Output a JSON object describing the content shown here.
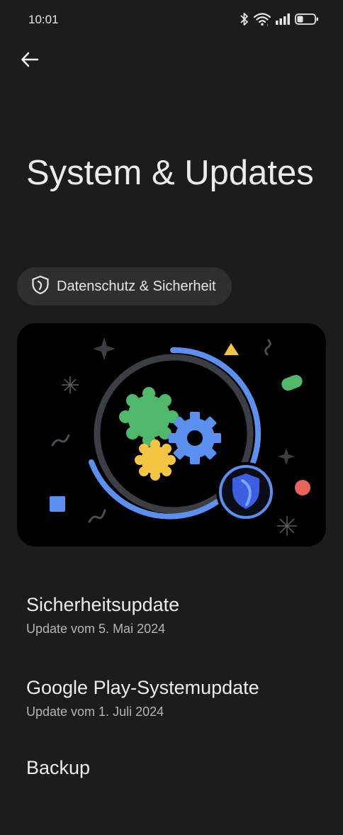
{
  "status_bar": {
    "time": "10:01",
    "icons": [
      "bluetooth-icon",
      "wifi-icon",
      "cell-signal-icon",
      "battery-icon"
    ],
    "battery_level": 0.35
  },
  "header": {
    "back_icon": "arrow-back-icon",
    "title": "System & Updates"
  },
  "chip": {
    "icon": "shield-icon",
    "label": "Datenschutz & Sicherheit"
  },
  "hero": {
    "illustration": "gears-and-shield-illustration",
    "colors": {
      "ring_blue": "#5b8ff0",
      "ring_gray": "#3b3e42",
      "green": "#4fb86a",
      "yellow": "#f4c542",
      "shield": "#3b5fe0",
      "red": "#e8645a"
    }
  },
  "list": [
    {
      "title": "Sicherheitsupdate",
      "subtitle": "Update vom 5. Mai 2024"
    },
    {
      "title": "Google Play-Systemupdate",
      "subtitle": "Update vom 1. Juli 2024"
    },
    {
      "title": "Backup",
      "subtitle": ""
    }
  ],
  "colors": {
    "background": "#1c1c1f",
    "chip_background": "#2e2f33",
    "text_primary": "#ececee",
    "text_secondary": "#b4b4b8"
  }
}
